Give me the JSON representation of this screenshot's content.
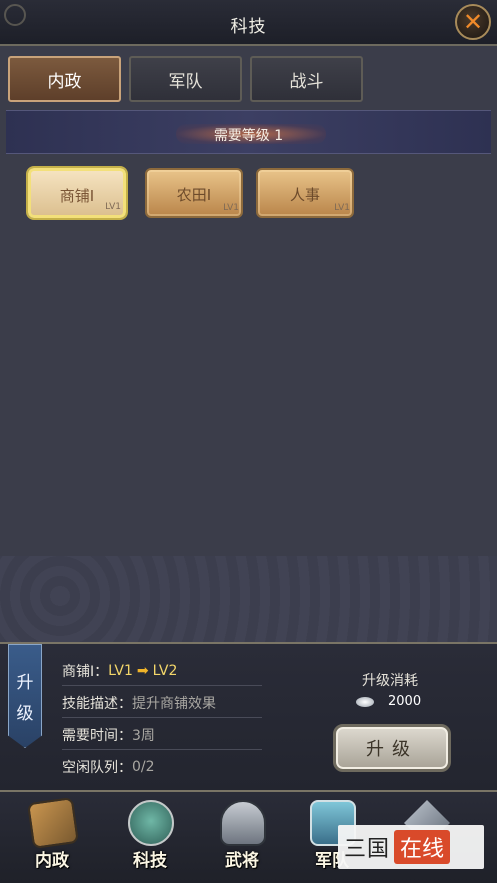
{
  "header": {
    "title": "科技"
  },
  "tabs": [
    {
      "label": "内政"
    },
    {
      "label": "军队"
    },
    {
      "label": "战斗"
    }
  ],
  "level_requirement": "需要等级 1",
  "techs": [
    {
      "name": "商铺I",
      "lv": "LV1"
    },
    {
      "name": "农田I",
      "lv": "LV1"
    },
    {
      "name": "人事",
      "lv": "LV1"
    }
  ],
  "upgrade_panel": {
    "ribbon_chars": [
      "升",
      "级"
    ],
    "tech_name": "商铺I：",
    "from_level": "LV1",
    "to_level": "LV2",
    "skill_desc_key": "技能描述：",
    "skill_desc_val": "提升商铺效果",
    "time_key": "需要时间：",
    "time_val": "3周",
    "queue_key": "空闲队列：",
    "queue_val": "0/2",
    "cost_title": "升级消耗",
    "cost_amount": "2000",
    "upgrade_button": "升级"
  },
  "bottom_nav": [
    {
      "label": "内政",
      "icon": "scroll-icon"
    },
    {
      "label": "科技",
      "icon": "jade-dragon-icon"
    },
    {
      "label": "武将",
      "icon": "helmet-icon"
    },
    {
      "label": "军队",
      "icon": "drum-icon"
    },
    {
      "label": "",
      "icon": "crossed-swords-icon"
    }
  ],
  "watermark": {
    "left": "三国",
    "right": "在线"
  }
}
